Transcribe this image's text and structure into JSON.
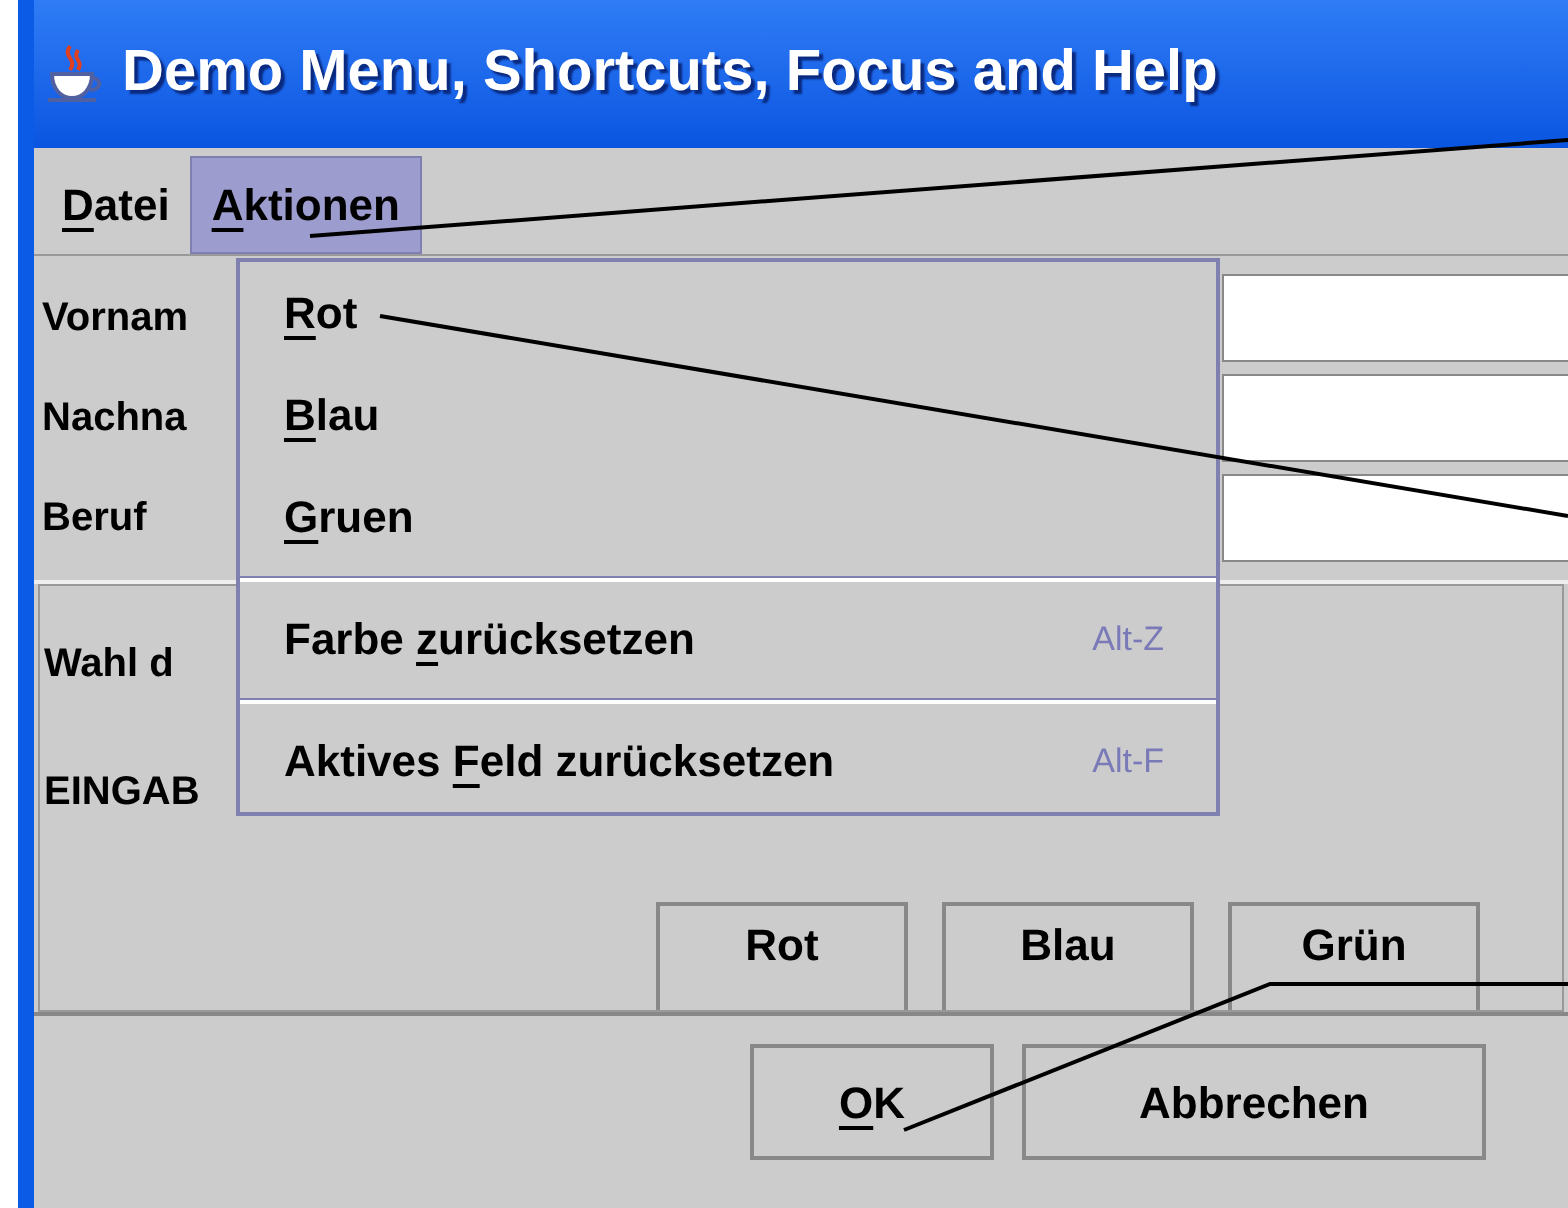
{
  "window": {
    "title": "Demo Menu, Shortcuts, Focus and Help"
  },
  "menu_bar": [
    {
      "label": {
        "key": "D",
        "post": "atei"
      },
      "selected": false
    },
    {
      "label": {
        "key": "A",
        "post": "ktionen"
      },
      "selected": true
    }
  ],
  "menu": {
    "items": [
      {
        "kind": "item",
        "label": {
          "key": "R",
          "post": "ot"
        }
      },
      {
        "kind": "item",
        "label": {
          "key": "B",
          "post": "lau"
        }
      },
      {
        "kind": "item",
        "label": {
          "key": "G",
          "post": "ruen"
        }
      },
      {
        "kind": "separator"
      },
      {
        "kind": "item",
        "label": {
          "pre": "Farbe ",
          "key": "z",
          "post": "urücksetzen"
        },
        "shortcut": "Alt-Z"
      },
      {
        "kind": "separator"
      },
      {
        "kind": "item",
        "label": {
          "pre": "Aktives ",
          "key": "F",
          "post": "eld zurücksetzen"
        },
        "shortcut": "Alt-F"
      }
    ]
  },
  "form": {
    "fields": [
      {
        "label": "Vornam"
      },
      {
        "label": "Nachna"
      },
      {
        "label": "Beruf"
      }
    ]
  },
  "panel": {
    "texts": [
      "Wahl d",
      "EINGAB"
    ],
    "color_buttons": [
      {
        "label": {
          "post": "Rot"
        }
      },
      {
        "label": {
          "post": "Blau"
        }
      },
      {
        "label": {
          "post": "Grün"
        }
      }
    ]
  },
  "dialog_buttons": [
    {
      "label": {
        "key": "O",
        "post": "K"
      }
    },
    {
      "label": {
        "post": "Abbrechen"
      }
    }
  ]
}
